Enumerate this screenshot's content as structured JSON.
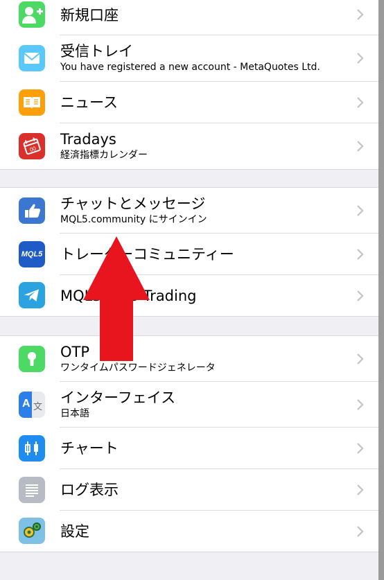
{
  "sections": [
    {
      "items": [
        {
          "title": "新規口座",
          "subtitle": "",
          "icon": "add-account-icon",
          "color": "#4cd964"
        },
        {
          "title": "受信トレイ",
          "subtitle": "You have registered a new account - MetaQuotes Ltd.",
          "icon": "mail-icon",
          "color": "#5ac8fa"
        },
        {
          "title": "ニュース",
          "subtitle": "",
          "icon": "book-icon",
          "color": "#ff9f0a"
        },
        {
          "title": "Tradays",
          "subtitle": "経済指標カレンダー",
          "icon": "tradays-calendar-icon",
          "color": "#d9302c"
        }
      ]
    },
    {
      "items": [
        {
          "title": "チャットとメッセージ",
          "subtitle": "MQL5.community にサインイン",
          "icon": "thumbs-chat-icon",
          "color": "#3b77d0"
        },
        {
          "title": "トレーダーコミュニティー",
          "subtitle": "",
          "icon": "mql5-logo-icon",
          "color": "#1e5bc6",
          "badge": "MQL5"
        },
        {
          "title": "MQL5 Algo Trading",
          "subtitle": "",
          "icon": "telegram-icon",
          "color": "#2aa3e0"
        }
      ]
    },
    {
      "items": [
        {
          "title": "OTP",
          "subtitle": "ワンタイムパスワードジェネレータ",
          "icon": "keyhole-icon",
          "color": "#4cd964"
        },
        {
          "title": "インターフェイス",
          "subtitle": "日本語",
          "icon": "translate-icon",
          "color": "#2c7fe8",
          "badge": "A"
        },
        {
          "title": "チャート",
          "subtitle": "",
          "icon": "candlestick-icon",
          "color": "#1f8cf0"
        },
        {
          "title": "ログ表示",
          "subtitle": "",
          "icon": "log-list-icon",
          "color": "#b7bcc4"
        },
        {
          "title": "設定",
          "subtitle": "",
          "icon": "settings-gears-icon",
          "color": "#7ec0e6"
        }
      ]
    }
  ],
  "overlay": {
    "icon": "red-up-arrow-icon",
    "color": "#e8141e"
  }
}
